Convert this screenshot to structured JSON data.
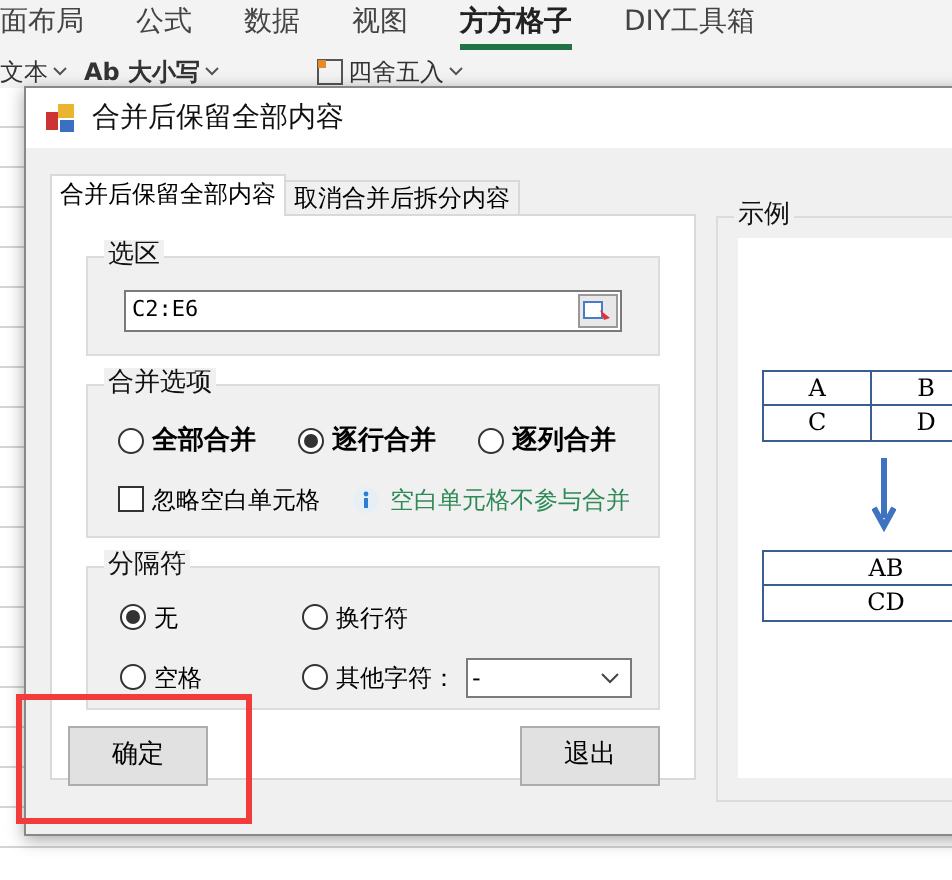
{
  "ribbon": {
    "tabs": [
      {
        "label": "面布局",
        "selected": false
      },
      {
        "label": "公式",
        "selected": false
      },
      {
        "label": "数据",
        "selected": false
      },
      {
        "label": "视图",
        "selected": false
      },
      {
        "label": "方方格子",
        "selected": true
      },
      {
        "label": "DIY工具箱",
        "selected": false
      }
    ],
    "tools": [
      {
        "label": "文本",
        "kind": "text"
      },
      {
        "label": "Ab 大小写",
        "kind": "case"
      },
      {
        "label": "四舍五入",
        "kind": "round"
      }
    ]
  },
  "dialog": {
    "title": "合并后保留全部内容",
    "tabs": [
      {
        "label": "合并后保留全部内容",
        "selected": true
      },
      {
        "label": "取消合并后拆分内容",
        "selected": false
      }
    ],
    "range": {
      "legend": "选区",
      "value": "C2:E6"
    },
    "merge": {
      "legend": "合并选项",
      "options": [
        {
          "label": "全部合并",
          "selected": false
        },
        {
          "label": "逐行合并",
          "selected": true
        },
        {
          "label": "逐列合并",
          "selected": false
        }
      ],
      "ignore_blank": {
        "label": "忽略空白单元格",
        "checked": false
      },
      "hint": "空白单元格不参与合并"
    },
    "separator": {
      "legend": "分隔符",
      "options": [
        {
          "label": "无",
          "selected": true,
          "kind": "plain"
        },
        {
          "label": "换行符",
          "selected": false,
          "kind": "plain"
        },
        {
          "label": "空格",
          "selected": false,
          "kind": "plain"
        },
        {
          "label": "其他字符：",
          "selected": false,
          "kind": "custom",
          "value": "-"
        }
      ]
    },
    "buttons": [
      {
        "label": "确定",
        "highlighted": true
      },
      {
        "label": "退出",
        "highlighted": false
      }
    ],
    "example": {
      "legend": "示例",
      "before": [
        [
          "A",
          "B"
        ],
        [
          "C",
          "D"
        ]
      ],
      "after": [
        "AB",
        "CD"
      ]
    }
  }
}
